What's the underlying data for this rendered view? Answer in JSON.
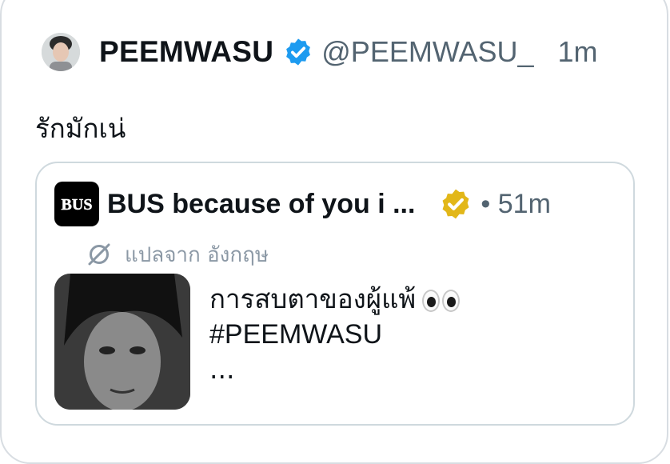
{
  "tweet": {
    "display_name": "PEEMWASU",
    "handle": "@PEEMWASU_",
    "time": "1m",
    "text": "รักมักเน่",
    "avatar_icon": "user-avatar",
    "verified_icon": "verified-badge-blue",
    "verified_color": "#1d9bf0"
  },
  "quote": {
    "name": "BUS because of you i ...",
    "time": "• 51m",
    "logo_text": "BUS",
    "verified_icon": "verified-badge-gold",
    "verified_color": "#e2b719",
    "translated_label": "แปลจาก อังกฤษ",
    "translate_icon": "translate-slash-icon",
    "body_line1": "การสบตาของผู้แพ้",
    "body_emoji": "eyes-emoji",
    "body_hashtag": "#PEEMWASU",
    "body_more": "..."
  },
  "colors": {
    "border": "#d8dde2",
    "secondary_text": "#536471",
    "translate_text": "#8b98a5"
  }
}
